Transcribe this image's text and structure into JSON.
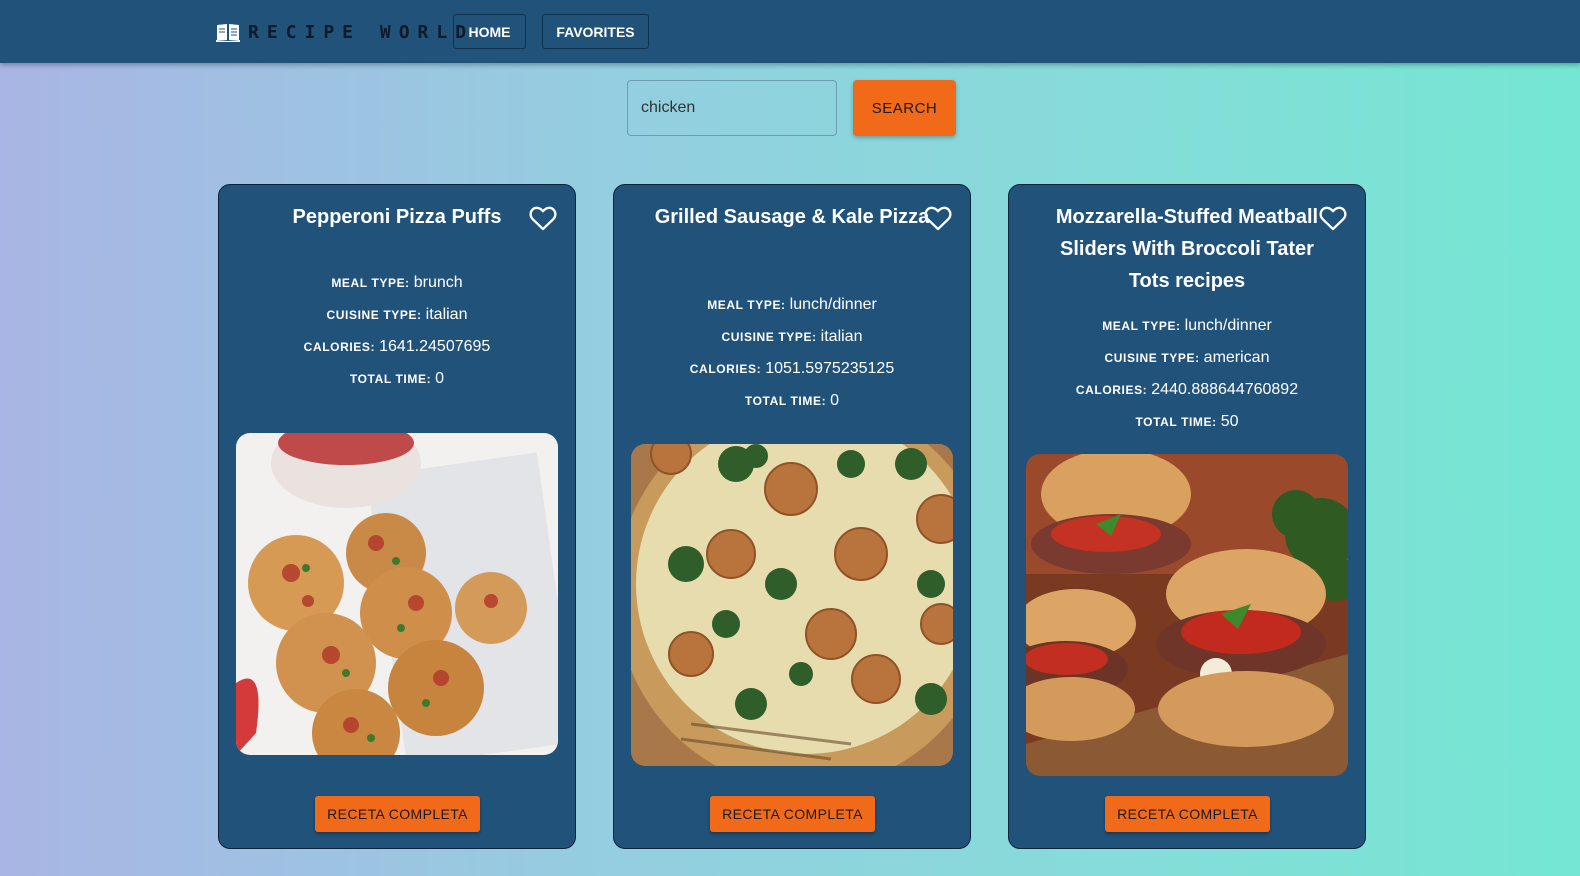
{
  "header": {
    "brand": "RECIPE WORLD",
    "nav": [
      {
        "label": "HOME"
      },
      {
        "label": "FAVORITES"
      }
    ]
  },
  "search": {
    "value": "chicken",
    "button_label": "SEARCH"
  },
  "labels": {
    "meal_type": "MEAL TYPE:",
    "cuisine_type": "CUISINE TYPE:",
    "calories": "CALORIES:",
    "total_time": "TOTAL TIME:"
  },
  "recipes": [
    {
      "title": "Pepperoni Pizza Puffs",
      "meal_type": "brunch",
      "cuisine_type": "italian",
      "calories": "1641.24507695",
      "total_time": "0",
      "button_label": "RECETA COMPLETA",
      "favorite_icon": "heart-outline-icon"
    },
    {
      "title": "Grilled Sausage & Kale Pizza",
      "meal_type": "lunch/dinner",
      "cuisine_type": "italian",
      "calories": "1051.5975235125",
      "total_time": "0",
      "button_label": "RECETA COMPLETA",
      "favorite_icon": "heart-outline-icon"
    },
    {
      "title": "Mozzarella-Stuffed Meatball Sliders With Broccoli Tater Tots recipes",
      "meal_type": "lunch/dinner",
      "cuisine_type": "american",
      "calories": "2440.888644760892",
      "total_time": "50",
      "button_label": "RECETA COMPLETA",
      "favorite_icon": "heart-outline-icon"
    }
  ],
  "colors": {
    "navbar": "#21527a",
    "card": "#21527a",
    "accent": "#f06a1a"
  }
}
